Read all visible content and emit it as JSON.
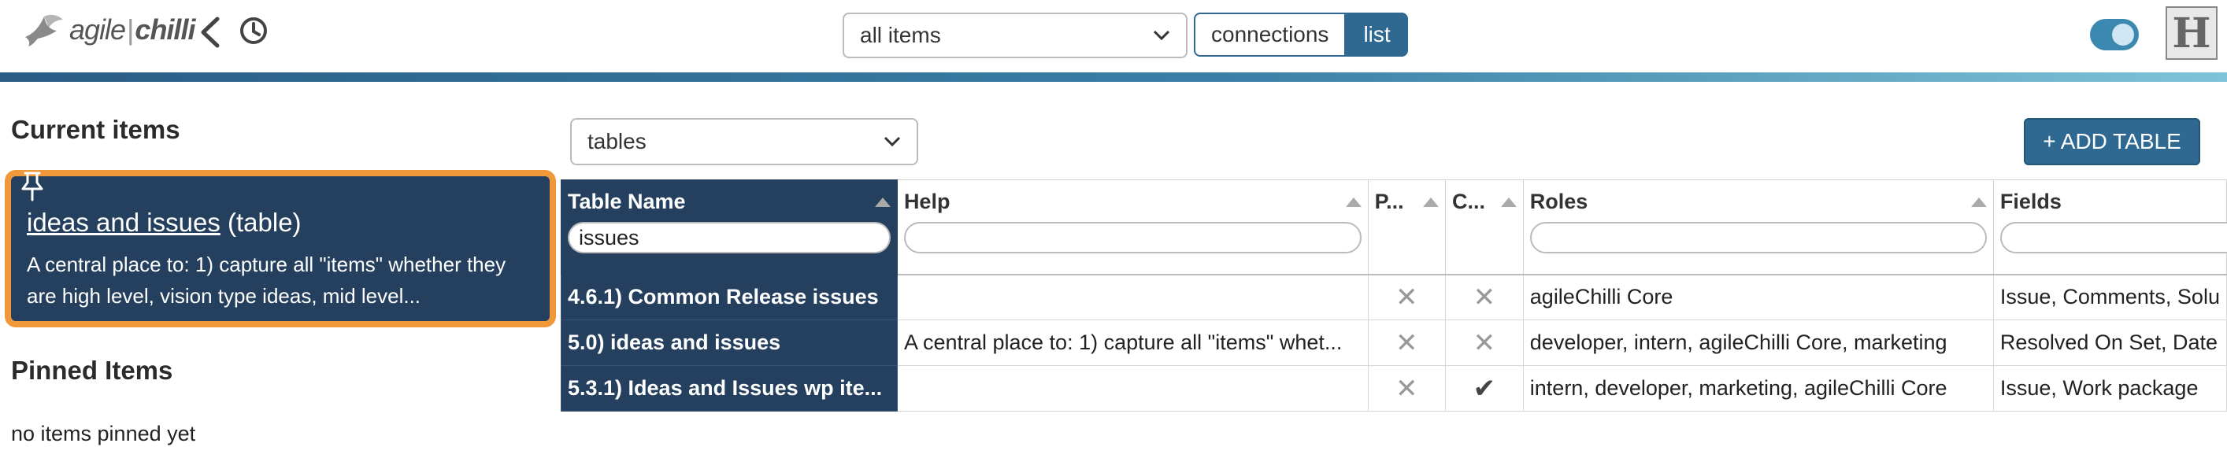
{
  "header": {
    "logo_text_left": "agile",
    "logo_text_sep": "|",
    "logo_text_right": "chilli",
    "view_select": "all items",
    "seg_connections": "connections",
    "seg_list": "list",
    "avatar_letter": "H"
  },
  "left": {
    "current_heading": "Current items",
    "card": {
      "title_link": "ideas and issues",
      "title_suffix": " (table)",
      "description": "A central place to: 1) capture all \"items\" whether they are high level, vision type ideas, mid level..."
    },
    "pinned_heading": "Pinned Items",
    "no_pinned": "no items pinned yet"
  },
  "tables": {
    "type_select": "tables",
    "add_button": "+ ADD TABLE",
    "columns": [
      "Table Name",
      "Help",
      "P...",
      "C...",
      "Roles",
      "Fields"
    ],
    "filter_value": "issues",
    "rows": [
      {
        "name": "4.6.1) Common Release issues",
        "help": "",
        "p": "✕",
        "c": "✕",
        "roles": "agileChilli Core",
        "fields": "Issue, Comments, Solu"
      },
      {
        "name": "5.0) ideas and issues",
        "help": "A central place to: 1) capture all \"items\" whet...",
        "p": "✕",
        "c": "✕",
        "roles": "developer, intern, agileChilli Core, marketing",
        "fields": "Resolved On Set, Date"
      },
      {
        "name": "5.3.1) Ideas and Issues wp ite...",
        "help": "",
        "p": "✕",
        "c": "✔",
        "roles": "intern, developer, marketing, agileChilli Core",
        "fields": "Issue, Work package"
      }
    ]
  },
  "colors": {
    "navy": "#24405e",
    "accent_blue": "#2f6891",
    "highlight_orange": "#f0993b"
  }
}
